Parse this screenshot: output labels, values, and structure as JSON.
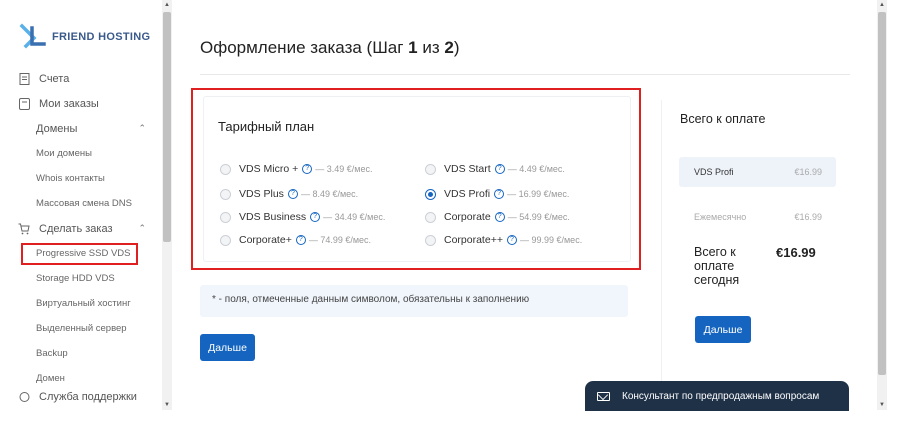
{
  "brand": {
    "name": "FRIEND HOSTING"
  },
  "sidebar": {
    "items": [
      {
        "label": "Счета",
        "icon": "document-icon"
      },
      {
        "label": "Мои заказы",
        "icon": "receipt-icon"
      },
      {
        "label": "Домены"
      },
      {
        "label": "Мои домены"
      },
      {
        "label": "Whois контакты"
      },
      {
        "label": "Массовая смена DNS"
      },
      {
        "label": "Сделать заказ",
        "icon": "cart-icon"
      },
      {
        "label": "Progressive SSD VDS"
      },
      {
        "label": "Storage HDD VDS"
      },
      {
        "label": "Виртуальный хостинг"
      },
      {
        "label": "Выделенный сервер"
      },
      {
        "label": "Backup"
      },
      {
        "label": "Домен"
      },
      {
        "label": "Служба поддержки",
        "icon": "support-icon"
      }
    ]
  },
  "page": {
    "title_prefix": "Оформление заказа (Шаг ",
    "step_current": "1",
    "step_mid": " из ",
    "step_total": "2",
    "title_suffix": ")"
  },
  "plan": {
    "title": "Тарифный план",
    "qmark": "?",
    "options": [
      {
        "name": "VDS Micro +",
        "price": "— 3.49 €/мес.",
        "selected": false
      },
      {
        "name": "VDS Start",
        "price": "— 4.49 €/мес.",
        "selected": false
      },
      {
        "name": "VDS Plus",
        "price": "— 8.49 €/мес.",
        "selected": false
      },
      {
        "name": "VDS Profi",
        "price": "— 16.99 €/мес.",
        "selected": true
      },
      {
        "name": "VDS Business",
        "price": "— 34.49 €/мес.",
        "selected": false
      },
      {
        "name": "Corporate",
        "price": "— 54.99 €/мес.",
        "selected": false
      },
      {
        "name": "Corporate+",
        "price": "— 74.99 €/мес.",
        "selected": false
      },
      {
        "name": "Corporate++",
        "price": "— 99.99 €/мес.",
        "selected": false
      }
    ]
  },
  "note": "* - поля, отмеченные данным символом, обязательны к заполнению",
  "buttons": {
    "next": "Дальше"
  },
  "summary": {
    "title": "Всего к оплате",
    "product_name": "VDS Profi",
    "product_price": "€16.99",
    "period_label": "Ежемесячно",
    "period_price": "€16.99",
    "total_label": "Всего к оплате сегодня",
    "total_value": "€16.99"
  },
  "chat": {
    "label": "Консультант по предпродажным вопросам"
  },
  "colors": {
    "accent": "#1565c0",
    "highlight": "#e02020",
    "chat_bg": "#1f3147"
  }
}
